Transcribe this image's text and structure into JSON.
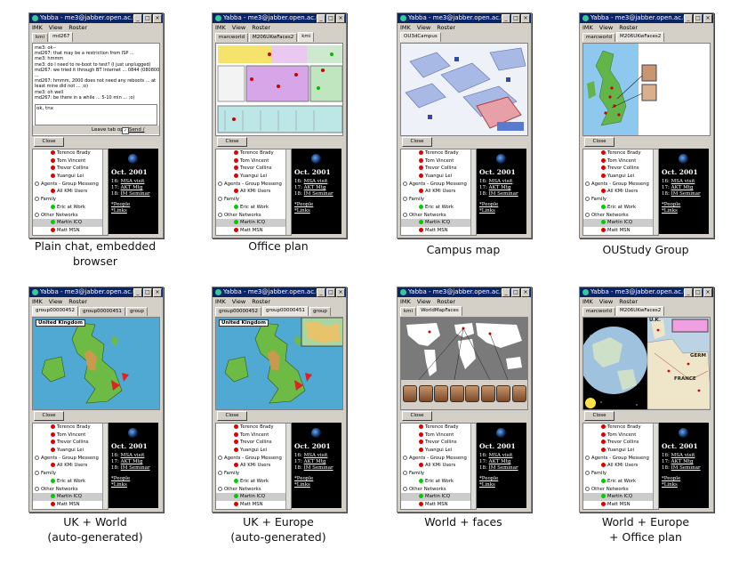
{
  "window": {
    "title": "Yabba - me3@jabber.open.ac.uk",
    "menu": [
      "IMK",
      "View",
      "Roster"
    ],
    "close_label": "Close"
  },
  "roster": [
    {
      "label": "Terence Brady",
      "type": "contact",
      "status": "red"
    },
    {
      "label": "Tom Vincent",
      "type": "contact",
      "status": "red"
    },
    {
      "label": "Trevor Collins",
      "type": "contact",
      "status": "red"
    },
    {
      "label": "Yuangui Lei",
      "type": "contact",
      "status": "red"
    },
    {
      "label": "Agents - Group Messeng",
      "type": "group"
    },
    {
      "label": "All KMi Users",
      "type": "contact",
      "status": "red"
    },
    {
      "label": "Family",
      "type": "group"
    },
    {
      "label": "Eric at Work",
      "type": "contact",
      "status": "green"
    },
    {
      "label": "Other Networks",
      "type": "group"
    },
    {
      "label": "Martin ICQ",
      "type": "contact",
      "status": "green",
      "selected": true
    },
    {
      "label": "Matt MSN",
      "type": "contact",
      "status": "red"
    }
  ],
  "calendar": {
    "month": "Oct. 2001",
    "events": [
      {
        "day": "16:",
        "label": "MSA visit"
      },
      {
        "day": "17:",
        "label": "AKT Mtg"
      },
      {
        "day": "18:",
        "label": "IM Seminar"
      }
    ],
    "links": [
      "*People",
      "*Links"
    ]
  },
  "chat": {
    "lines": [
      "me3: ok--",
      "md267: that may be a restriction from ISP ...",
      "me3: hmmm",
      "me3: do I need to re-boot to test? (I just unplugged)",
      "md267: we tried it through BT Internet ... 0844 (0808005",
      "...",
      "md267: hmmm, 2000 does not need any reboots ... at",
      "least mine did not ... ;o)",
      "me3: oh well",
      "md267: be there in a while ... 5-10 min ... ;o)"
    ],
    "input_value": "ok, tnx",
    "leave_tab_label": "Leave tab open",
    "send_label": "Send / Reply"
  },
  "panels": [
    {
      "id": "p1",
      "tabs": [
        "kmi",
        "md267"
      ],
      "active": 1,
      "content": "chat",
      "caption": [
        "Plain chat, embedded",
        "browser"
      ]
    },
    {
      "id": "p2",
      "tabs": [
        "marcworld",
        "M206UKwFaces2",
        "kmi"
      ],
      "active": 2,
      "content": "office",
      "caption": [
        "Office plan"
      ]
    },
    {
      "id": "p3",
      "tabs": [
        "OU3dCampus"
      ],
      "active": 0,
      "content": "campus",
      "caption": [
        "Campus map"
      ]
    },
    {
      "id": "p4",
      "tabs": [
        "marcworld",
        "M206UKwFaces2"
      ],
      "active": 1,
      "content": "oustudy",
      "caption": [
        "OUStudy Group"
      ]
    },
    {
      "id": "p5",
      "tabs": [
        "group00000452",
        "group00000451",
        "group"
      ],
      "active": 0,
      "content": "uk",
      "map_label": "United Kingdom",
      "caption": [
        "UK + World",
        "(auto-generated)"
      ]
    },
    {
      "id": "p6",
      "tabs": [
        "group00000452",
        "group00000451",
        "group"
      ],
      "active": 1,
      "content": "ukeurope",
      "map_label": "United Kingdom",
      "caption": [
        "UK + Europe",
        "(auto-generated)"
      ]
    },
    {
      "id": "p7",
      "tabs": [
        "kmi",
        "WorldMapFaces"
      ],
      "active": 1,
      "content": "worldfaces",
      "caption": [
        "World + faces"
      ]
    },
    {
      "id": "p8",
      "tabs": [
        "marcworld",
        "M206UKwFaces2"
      ],
      "active": 1,
      "content": "worldeurope",
      "map_labels": [
        "U.K.",
        "GERM",
        "FRANCE"
      ],
      "caption": [
        "World + Europe",
        "+ Office plan"
      ]
    }
  ]
}
